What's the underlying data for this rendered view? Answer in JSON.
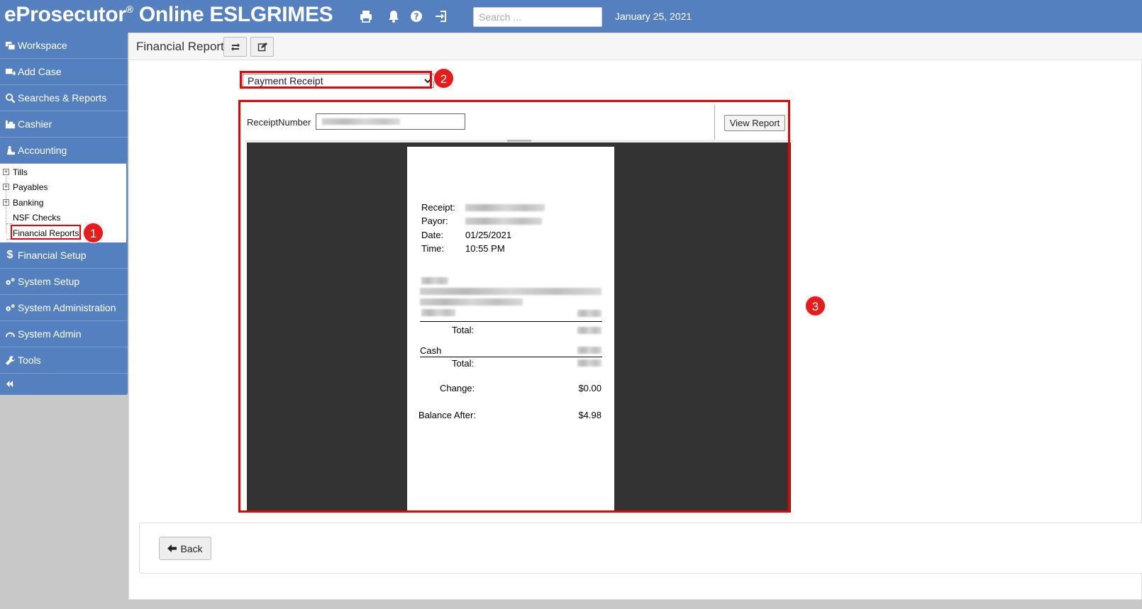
{
  "header": {
    "brand": "eProsecutor",
    "brand_mark": "®",
    "brand_suffix": " Online ESLGRIMES",
    "search_placeholder": "Search ...",
    "date": "January 25, 2021",
    "icons": [
      "printer-icon",
      "bell-icon",
      "help-icon",
      "logout-icon"
    ]
  },
  "sidebar": {
    "items_top": [
      {
        "label": "Workspace",
        "icon": "workspace-icon"
      },
      {
        "label": "Add Case",
        "icon": "add-case-icon"
      },
      {
        "label": "Searches & Reports",
        "icon": "search-icon"
      },
      {
        "label": "Cashier",
        "icon": "cashier-icon"
      },
      {
        "label": "Accounting",
        "icon": "accounting-icon"
      }
    ],
    "accounting_tree": [
      {
        "label": "Tills",
        "expandable": true
      },
      {
        "label": "Payables",
        "expandable": true
      },
      {
        "label": "Banking",
        "expandable": true
      },
      {
        "label": "NSF Checks",
        "expandable": false
      },
      {
        "label": "Financial Reports",
        "expandable": false,
        "selected": true
      }
    ],
    "items_bottom": [
      {
        "label": "Financial Setup",
        "icon": "dollar-icon"
      },
      {
        "label": "System Setup",
        "icon": "gears-icon"
      },
      {
        "label": "System Administration",
        "icon": "gears-icon"
      },
      {
        "label": "System Admin",
        "icon": "dashboard-icon"
      },
      {
        "label": "Tools",
        "icon": "wrench-icon"
      }
    ],
    "collapse_icon": "double-chevron-left-icon"
  },
  "main": {
    "tab_title": "Financial Reports",
    "report_select": {
      "selected": "Payment Receipt",
      "options": [
        "Payment Receipt"
      ]
    },
    "params": {
      "label": "ReceiptNumber",
      "view_button": "View Report"
    },
    "receipt": {
      "receipt_label": "Receipt:",
      "payor_label": "Payor:",
      "date_label": "Date:",
      "date_value": "01/25/2021",
      "time_label": "Time:",
      "time_value": "10:55 PM",
      "total_label": "Total:",
      "cash_label": "Cash",
      "total2_label": "Total:",
      "change_label": "Change:",
      "change_value": "$0.00",
      "balance_label": "Balance After:",
      "balance_value": "$4.98"
    },
    "back_button": "Back"
  },
  "annotations": {
    "badge1": "1",
    "badge2": "2",
    "badge3": "3",
    "color": "#e61c1c"
  },
  "colors": {
    "header_bg": "#5580bf",
    "viewer_bg": "#333333"
  }
}
